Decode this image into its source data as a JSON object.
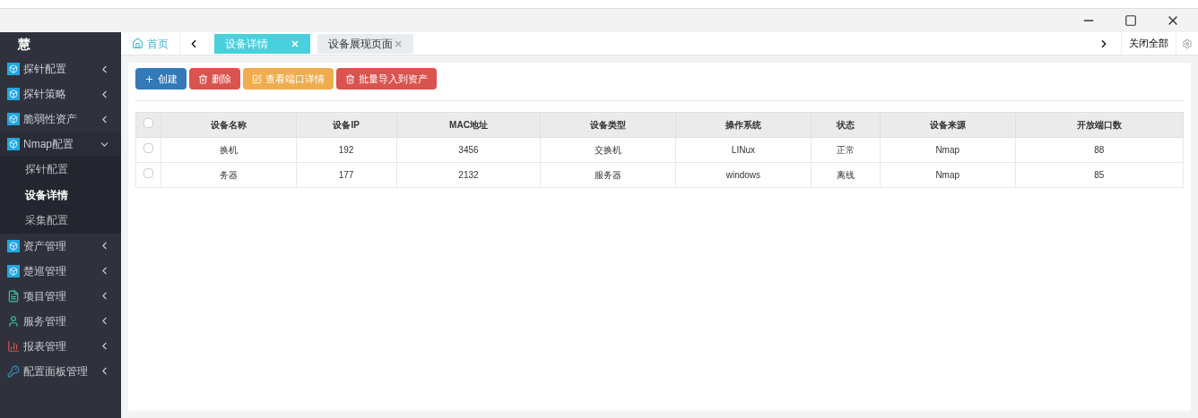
{
  "brand": "慧",
  "sidebar": {
    "items": [
      {
        "label": "探针配置",
        "kind": "cube",
        "expanded": false
      },
      {
        "label": "探针策略",
        "kind": "cube",
        "expanded": false
      },
      {
        "label": "脆弱性资产",
        "kind": "cube",
        "expanded": false
      },
      {
        "label": "Nmap配置",
        "kind": "cube",
        "expanded": true,
        "children": [
          {
            "label": "探针配置",
            "selected": false
          },
          {
            "label": "设备详情",
            "selected": true
          },
          {
            "label": "采集配置",
            "selected": false
          }
        ]
      },
      {
        "label": "资产管理",
        "kind": "cube",
        "expanded": false
      },
      {
        "label": "楚巡管理",
        "kind": "cube",
        "expanded": false
      },
      {
        "label": "项目管理",
        "kind": "doc",
        "expanded": false
      },
      {
        "label": "服务管理",
        "kind": "user",
        "expanded": false
      },
      {
        "label": "报表管理",
        "kind": "chart",
        "expanded": false
      },
      {
        "label": "配置面板管理",
        "kind": "key",
        "expanded": false
      }
    ]
  },
  "home": "首页",
  "tabs": [
    {
      "label": "设备详情",
      "selected": true
    },
    {
      "label": "设备展现页面",
      "selected": false
    }
  ],
  "close_all": "关闭全部",
  "toolbar": [
    {
      "label": "创建",
      "color": "#337ab7",
      "kind": "plus"
    },
    {
      "label": "删除",
      "color": "#d9534f",
      "kind": "trash"
    },
    {
      "label": "查看端口详情",
      "color": "#f0ad4e",
      "kind": "edit"
    },
    {
      "label": "批量导入到资产",
      "color": "#d9534f",
      "kind": "trash"
    }
  ],
  "table": {
    "select_all": {
      "checked": false
    },
    "columns": [
      "设备名称",
      "设备IP",
      "MAC地址",
      "设备类型",
      "操作系统",
      "状态",
      "设备来源",
      "开放端口数"
    ],
    "rows": [
      {
        "checked": false,
        "cells": [
          "换机",
          "192",
          "3456",
          "交换机",
          "LINux",
          "正常",
          "Nmap",
          "88"
        ]
      },
      {
        "checked": false,
        "cells": [
          "务器",
          "177",
          "2132",
          "服务器",
          "windows",
          "离线",
          "Nmap",
          "85"
        ]
      }
    ]
  }
}
